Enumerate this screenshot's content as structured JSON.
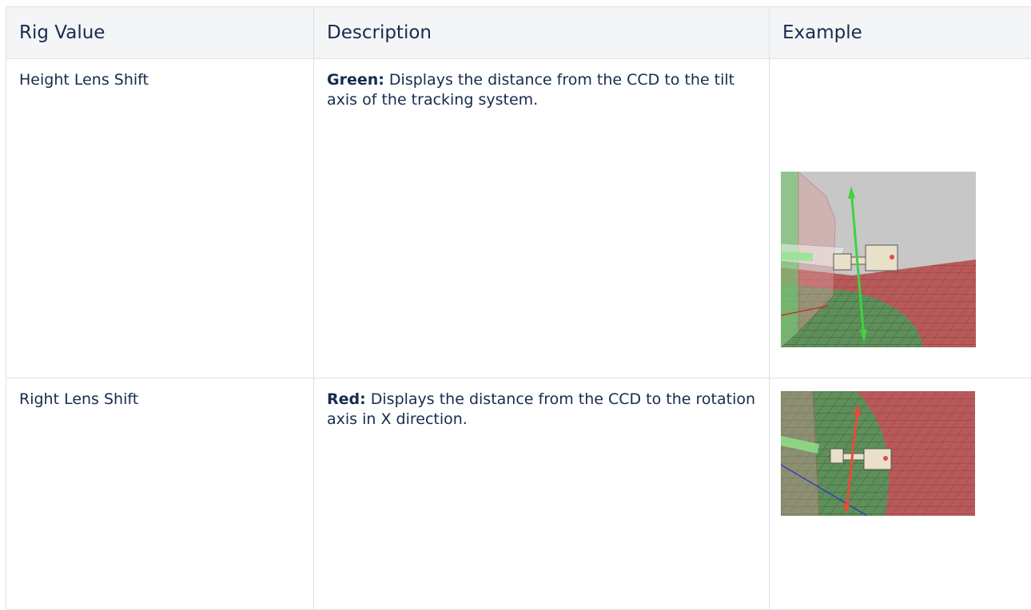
{
  "table": {
    "headers": [
      "Rig Value",
      "Description",
      "Example"
    ],
    "rows": [
      {
        "rig_value": "Height Lens Shift",
        "desc_label": "Green:",
        "desc_text": " Displays the distance from the CCD to the tilt axis of the tracking system.",
        "example_icon": "height-lens-shift-3d-render"
      },
      {
        "rig_value": "Right Lens Shift",
        "desc_label": "Red:",
        "desc_text": " Displays the distance from the CCD to the rotation axis in X direction.",
        "example_icon": "right-lens-shift-3d-render"
      }
    ]
  },
  "colors": {
    "header_bg": "#f4f5f7",
    "border": "#dfe1e6",
    "text": "#172b4d"
  }
}
